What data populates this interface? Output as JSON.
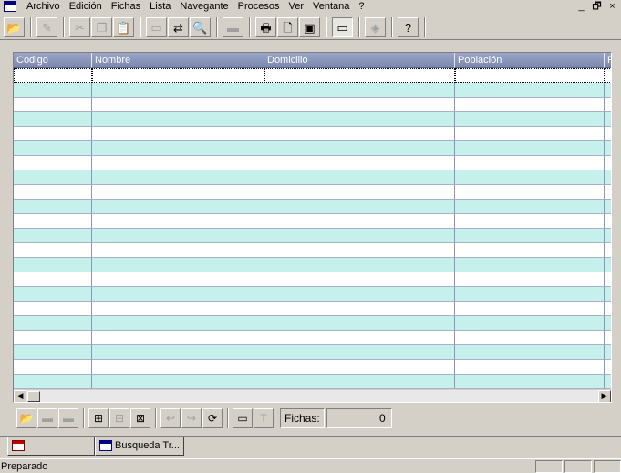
{
  "menubar": {
    "items": [
      "Archivo",
      "Edición",
      "Fichas",
      "Lista",
      "Navegante",
      "Procesos",
      "Ver",
      "Ventana",
      "?"
    ],
    "window_controls": [
      "_",
      "🗗",
      "×"
    ]
  },
  "toolbar": {
    "buttons": [
      {
        "icon": "open-folder-icon",
        "glyph": "📂"
      },
      {
        "icon": "edit-icon",
        "glyph": "✎"
      },
      {
        "icon": "cut-icon",
        "glyph": "✂"
      },
      {
        "icon": "copy-icon",
        "glyph": "❐"
      },
      {
        "icon": "paste-icon",
        "glyph": "📋"
      },
      {
        "icon": "window-icon",
        "glyph": "▭"
      },
      {
        "icon": "find-icon",
        "glyph": "⇄"
      },
      {
        "icon": "search-icon",
        "glyph": "🔍"
      },
      {
        "icon": "scanner-icon",
        "glyph": "▬"
      },
      {
        "icon": "print-icon",
        "glyph": "🖶"
      },
      {
        "icon": "print-preview-icon",
        "glyph": "🗋"
      },
      {
        "icon": "save-icon",
        "glyph": "▣"
      },
      {
        "icon": "monitor-icon",
        "glyph": "▭"
      },
      {
        "icon": "eraser-icon",
        "glyph": "◈"
      },
      {
        "icon": "help-icon",
        "glyph": "?"
      }
    ]
  },
  "grid": {
    "columns": [
      "Codigo",
      "Nombre",
      "Domicilio",
      "Población",
      "P"
    ],
    "row_count": 22
  },
  "navbar": {
    "buttons": [
      {
        "icon": "folder-open-icon",
        "glyph": "📂"
      },
      {
        "icon": "folder-icon",
        "glyph": "▬"
      },
      {
        "icon": "folder-closed-icon",
        "glyph": "▬"
      },
      {
        "icon": "tree-add-icon",
        "glyph": "⊞"
      },
      {
        "icon": "tree-remove-icon",
        "glyph": "⊟"
      },
      {
        "icon": "tree-delete-icon",
        "glyph": "⊠"
      },
      {
        "icon": "back-icon",
        "glyph": "↩"
      },
      {
        "icon": "forward-icon",
        "glyph": "↪"
      },
      {
        "icon": "refresh-icon",
        "glyph": "⟳"
      },
      {
        "icon": "form-icon",
        "glyph": "▭"
      },
      {
        "icon": "text-icon",
        "glyph": "T"
      }
    ],
    "fichas_label": "Fichas:",
    "fichas_value": "0"
  },
  "tabs": [
    {
      "label": ""
    },
    {
      "label": "Busqueda Tr..."
    }
  ],
  "status": {
    "text": "Preparado"
  },
  "colors": {
    "header": "#8890b8",
    "row_alt": "#c6f0ec"
  }
}
